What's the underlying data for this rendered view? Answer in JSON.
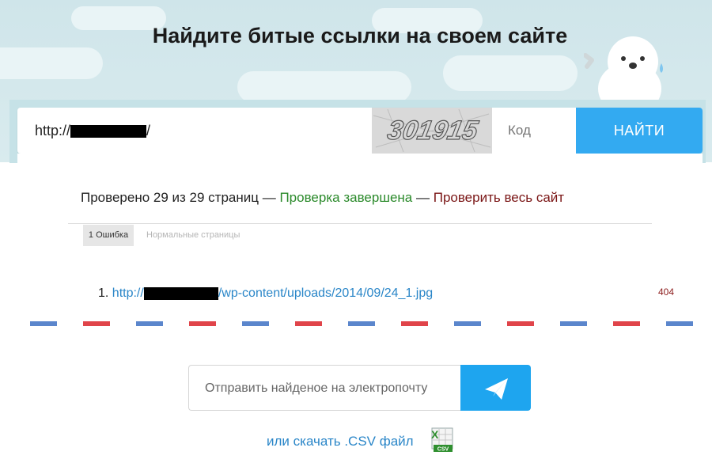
{
  "header": {
    "title": "Найдите битые ссылки на своем сайте"
  },
  "search": {
    "url_prefix": "http://",
    "url_suffix": "/",
    "captcha_text": "301915",
    "code_placeholder": "Код",
    "find_label": "НАЙТИ"
  },
  "status": {
    "checked": "Проверено 29 из 29 страниц",
    "sep1": " — ",
    "complete": "Проверка завершена",
    "sep2": " — ",
    "check_all": "Проверить весь сайт"
  },
  "tabs": [
    {
      "label": "1 Ошибка"
    },
    {
      "label": "Нормальные страницы"
    }
  ],
  "errors": [
    {
      "index": "1.",
      "url_prefix": "http://",
      "url_suffix": "/wp-content/uploads/2014/09/24_1.jpg",
      "code": "404"
    }
  ],
  "email": {
    "placeholder": "Отправить найденое на электропочту"
  },
  "download": {
    "label": "или скачать .CSV файл",
    "icon_label": "CSV"
  },
  "colors": {
    "accent": "#33aaf1",
    "success": "#2b8a2b",
    "danger": "#7a1515",
    "link": "#2a86c8"
  }
}
